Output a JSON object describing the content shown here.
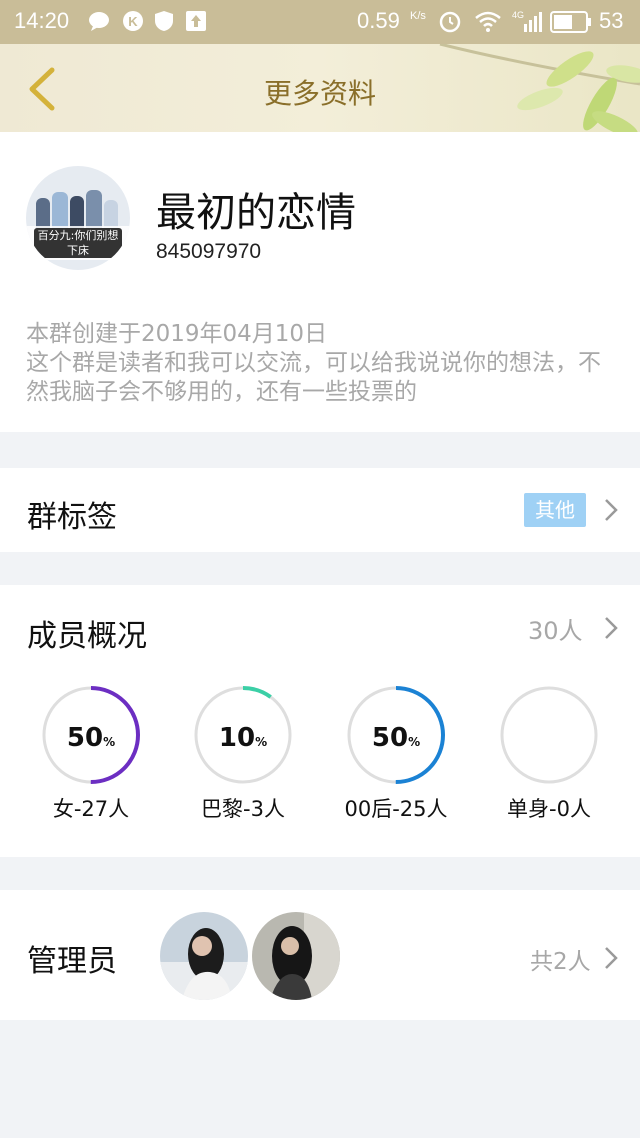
{
  "status_bar": {
    "time": "14:20",
    "network_speed": "0.59",
    "speed_unit": "K/s",
    "network_type": "4G",
    "battery": "53",
    "icons": [
      "chat-icon",
      "k-app-icon",
      "shield-icon",
      "upload-icon",
      "alarm-icon",
      "wifi-icon",
      "signal-icon",
      "battery-icon"
    ]
  },
  "header": {
    "title": "更多资料",
    "back_icon": "chevron-left-icon"
  },
  "profile": {
    "name": "最初的恋情",
    "group_id": "845097970",
    "avatar_caption": "百分九:你们别想下床",
    "created": "本群创建于2019年04月10日",
    "description": "这个群是读者和我可以交流，可以给我说说你的想法，不然我脑子会不够用的，还有一些投票的"
  },
  "tags": {
    "label": "群标签",
    "tag": "其他"
  },
  "members": {
    "label": "成员概况",
    "count": "30人",
    "stats": [
      {
        "percent": "50",
        "unit": "%",
        "label": "女-27人",
        "fraction": 0.5,
        "color": "#6c2ec2"
      },
      {
        "percent": "10",
        "unit": "%",
        "label": "巴黎-3人",
        "fraction": 0.1,
        "color": "#3bcfa6"
      },
      {
        "percent": "50",
        "unit": "%",
        "label": "00后-25人",
        "fraction": 0.5,
        "color": "#1b82d4"
      },
      {
        "percent": "",
        "unit": "",
        "label": "单身-0人",
        "fraction": 0,
        "color": "#d6d6d6"
      }
    ]
  },
  "admins": {
    "label": "管理员",
    "count": "共2人"
  },
  "colors": {
    "status_bar": "#c9bd98",
    "title_text": "#8a6f2a",
    "tag_badge": "#9fd1f5",
    "ring_track": "#dedede"
  }
}
